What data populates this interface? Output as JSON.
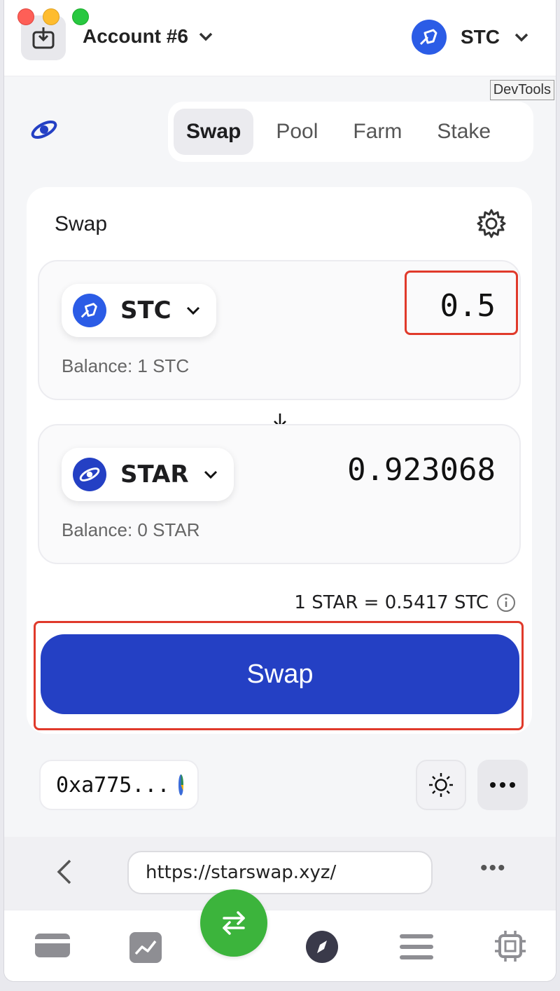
{
  "window": {
    "traffic_lights": [
      "close",
      "minimize",
      "zoom"
    ]
  },
  "topbar": {
    "account_label": "Account #6",
    "network_label": "STC"
  },
  "devtools_label": "DevTools",
  "dapp": {
    "tabs": [
      {
        "label": "Swap",
        "active": true
      },
      {
        "label": "Pool",
        "active": false
      },
      {
        "label": "Farm",
        "active": false
      },
      {
        "label": "Stake",
        "active": false
      }
    ],
    "card": {
      "title": "Swap",
      "from": {
        "token": "STC",
        "amount": "0.5",
        "balance": "Balance: 1 STC"
      },
      "to": {
        "token": "STAR",
        "amount": "0.923068",
        "balance": "Balance: 0 STAR"
      },
      "rate": "1 STAR = 0.5417 STC",
      "swap_button": "Swap"
    }
  },
  "footer": {
    "address": "0xa775..."
  },
  "urlbar": {
    "url": "https://starswap.xyz/",
    "more": "•••"
  },
  "colors": {
    "accent": "#2440c4",
    "stc_logo": "#2b5ce6",
    "star_logo": "#2440c4",
    "highlight": "#e03a2b",
    "center_button": "#3cb43c"
  }
}
